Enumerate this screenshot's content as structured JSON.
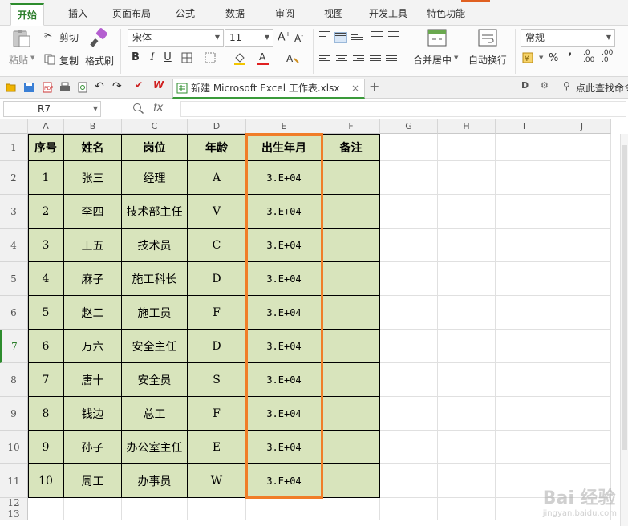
{
  "menu_tabs": [
    "开始",
    "插入",
    "页面布局",
    "公式",
    "数据",
    "审阅",
    "视图",
    "开发工具",
    "特色功能"
  ],
  "active_tab": "开始",
  "ribbon": {
    "paste": "粘贴",
    "cut": "剪切",
    "copy": "复制",
    "format_painter": "格式刷",
    "font_name": "宋体",
    "font_size": "11",
    "merge_center": "合并居中",
    "wrap_text": "自动换行",
    "number_format": "常规",
    "percent": "%",
    "comma": "’",
    "dec_up": ".0\n.00",
    "dec_down": ".00\n.0"
  },
  "quickbar": {
    "file_tab": "新建 Microsoft Excel 工作表.xlsx",
    "search": "点此查找命令"
  },
  "formula_bar": {
    "name_box": "R7",
    "fx": "fx",
    "formula": ""
  },
  "columns": [
    "A",
    "B",
    "C",
    "D",
    "E",
    "F",
    "G",
    "H",
    "I",
    "J"
  ],
  "rows": [
    "1",
    "2",
    "3",
    "4",
    "5",
    "6",
    "7",
    "8",
    "9",
    "10",
    "11",
    "12",
    "13"
  ],
  "selected_row": "7",
  "table": {
    "headers": [
      "序号",
      "姓名",
      "岗位",
      "年龄",
      "出生年月",
      "备注"
    ],
    "rows": [
      [
        "1",
        "张三",
        "经理",
        "A",
        "3.E+04",
        ""
      ],
      [
        "2",
        "李四",
        "技术部主任",
        "V",
        "3.E+04",
        ""
      ],
      [
        "3",
        "王五",
        "技术员",
        "C",
        "3.E+04",
        ""
      ],
      [
        "4",
        "麻子",
        "施工科长",
        "D",
        "3.E+04",
        ""
      ],
      [
        "5",
        "赵二",
        "施工员",
        "F",
        "3.E+04",
        ""
      ],
      [
        "6",
        "万六",
        "安全主任",
        "D",
        "3.E+04",
        ""
      ],
      [
        "7",
        "唐十",
        "安全员",
        "S",
        "3.E+04",
        ""
      ],
      [
        "8",
        "钱边",
        "总工",
        "F",
        "3.E+04",
        ""
      ],
      [
        "9",
        "孙子",
        "办公室主任",
        "E",
        "3.E+04",
        ""
      ],
      [
        "10",
        "周工",
        "办事员",
        "W",
        "3.E+04",
        ""
      ]
    ]
  },
  "colors": {
    "accent_green": "#2d8c2d",
    "table_fill": "#d8e4bc",
    "highlight_border": "#f07d28"
  },
  "watermark": {
    "logo": "Bai 经验",
    "url": "jingyan.baidu.com"
  }
}
